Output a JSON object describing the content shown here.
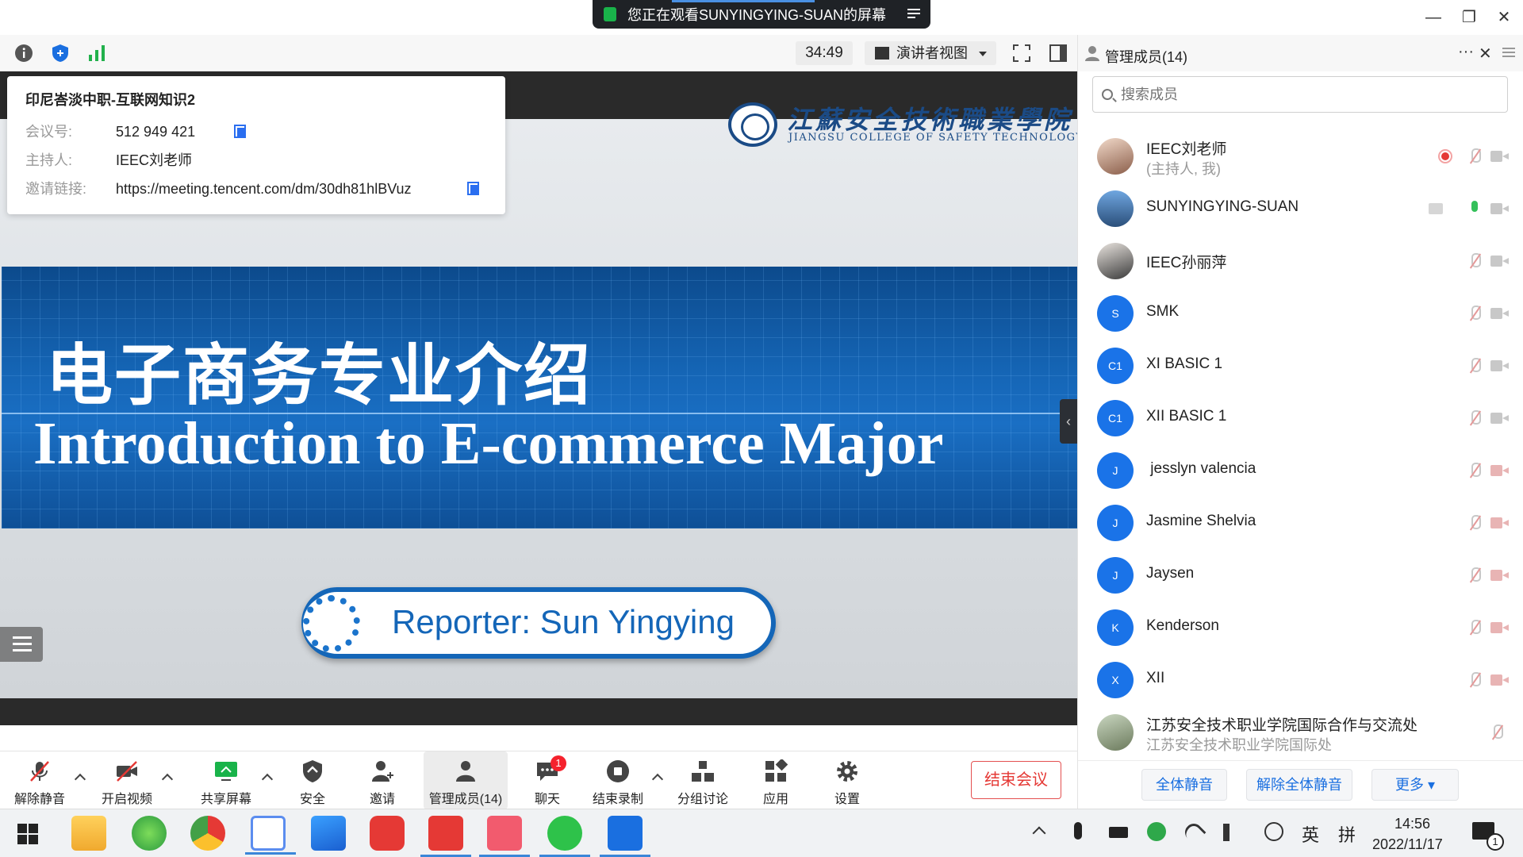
{
  "title_bar": {
    "share_banner": "您正在观看SUNYINGYING-SUAN的屏幕",
    "minimize_glyph": "—",
    "restore_glyph": "❐",
    "close_glyph": "✕"
  },
  "toolbar": {
    "timer": "34:49",
    "view_mode": "演讲者视图",
    "signal_color": "#22b14c"
  },
  "meeting_info": {
    "title": "印尼峇淡中职-互联网知识2",
    "id_label": "会议号:",
    "id_value": "512 949 421",
    "host_label": "主持人:",
    "host_value": "IEEC刘老师",
    "link_label": "邀请链接:",
    "link_value": "https://meeting.tencent.com/dm/30dh81hlBVuz"
  },
  "slide": {
    "college_cn": "江蘇安全技術職業學院",
    "college_en": "JIANGSU COLLEGE OF SAFETY TECHNOLOGY",
    "heading_cn": "电子商务专业介绍",
    "heading_en": "Introduction to E-commerce Major",
    "reporter": "Reporter: Sun Yingying"
  },
  "panel": {
    "title": "管理成员(14)",
    "more_glyph": "···",
    "close_glyph": "✕",
    "search_placeholder": "搜索成员",
    "members": [
      {
        "name": "IEEC刘老师",
        "sub": "(主持人, 我)",
        "avatar": ""
      },
      {
        "name": "SUNYINGYING-SUAN",
        "sub": "",
        "avatar": ""
      },
      {
        "name": "IEEC孙丽萍",
        "sub": "",
        "avatar": ""
      },
      {
        "name": "SMK",
        "sub": "",
        "avatar": "S"
      },
      {
        "name": "XI BASIC 1",
        "sub": "",
        "avatar": "C1"
      },
      {
        "name": "XII BASIC 1",
        "sub": "",
        "avatar": "C1"
      },
      {
        "name": " jesslyn valencia",
        "sub": "",
        "avatar": "J"
      },
      {
        "name": "Jasmine Shelvia",
        "sub": "",
        "avatar": "J"
      },
      {
        "name": "Jaysen",
        "sub": "",
        "avatar": "J"
      },
      {
        "name": "Kenderson",
        "sub": "",
        "avatar": "K"
      },
      {
        "name": "XII",
        "sub": "",
        "avatar": "X"
      },
      {
        "name": "江苏安全技术职业学院国际合作与交流处",
        "sub": "江苏安全技术职业学院国际处",
        "avatar": ""
      }
    ],
    "mute_all": "全体静音",
    "unmute_all": "解除全体静音",
    "more": "更多 ▾"
  },
  "bottom_bar": {
    "unmute": "解除静音",
    "start_video": "开启视频",
    "share_screen": "共享屏幕",
    "security": "安全",
    "invite": "邀请",
    "members": "管理成员(14)",
    "chat": "聊天",
    "chat_badge": "1",
    "stop_record": "结束录制",
    "breakout": "分组讨论",
    "apps": "应用",
    "settings": "设置",
    "end_meeting": "结束会议"
  },
  "taskbar": {
    "ime_lang": "英",
    "ime_mode": "拼",
    "time": "14:56",
    "date": "2022/11/17",
    "notification_count": "1"
  }
}
